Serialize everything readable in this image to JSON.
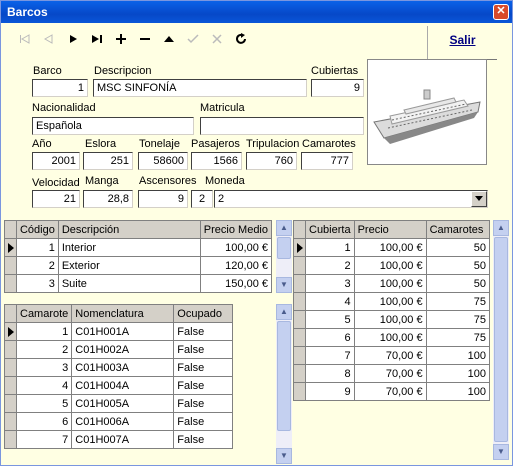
{
  "window": {
    "title": "Barcos",
    "close_glyph": "✕"
  },
  "toolbar": {
    "buttons": [
      "first-icon",
      "prev-icon",
      "next-icon",
      "last-icon",
      "add-icon",
      "remove-icon",
      "up-icon",
      "edit-icon",
      "cancel-icon",
      "refresh-icon"
    ],
    "exit_label": "Salir"
  },
  "form": {
    "barco_label": "Barco",
    "barco_value": "1",
    "descripcion_label": "Descripcion",
    "descripcion_value": "MSC SINFONÍA",
    "cubiertas_label": "Cubiertas",
    "cubiertas_value": "9",
    "nacionalidad_label": "Nacionalidad",
    "nacionalidad_value": "Española",
    "matricula_label": "Matricula",
    "matricula_value": "",
    "anio_label": "Año",
    "anio_value": "2001",
    "eslora_label": "Eslora",
    "eslora_value": "251",
    "tonelaje_label": "Tonelaje",
    "tonelaje_value": "58600",
    "pasajeros_label": "Pasajeros",
    "pasajeros_value": "1566",
    "tripulacion_label": "Tripulacion",
    "tripulacion_value": "760",
    "camarotes_label": "Camarotes",
    "camarotes_value": "777",
    "velocidad_label": "Velocidad",
    "velocidad_value": "21",
    "manga_label": "Manga",
    "manga_value": "28,8",
    "ascensores_label": "Ascensores",
    "ascensores_value": "9",
    "moneda_label": "Moneda",
    "moneda_code": "2",
    "moneda_value": "2"
  },
  "categorias": {
    "headers": [
      "Código",
      "Descripción",
      "Precio Medio"
    ],
    "rows": [
      [
        "1",
        "Interior",
        "100,00 €"
      ],
      [
        "2",
        "Exterior",
        "120,00 €"
      ],
      [
        "3",
        "Suite",
        "150,00 €"
      ]
    ]
  },
  "cubiertas": {
    "headers": [
      "Cubierta",
      "Precio",
      "Camarotes"
    ],
    "rows": [
      [
        "1",
        "100,00 €",
        "50"
      ],
      [
        "2",
        "100,00 €",
        "50"
      ],
      [
        "3",
        "100,00 €",
        "50"
      ],
      [
        "4",
        "100,00 €",
        "75"
      ],
      [
        "5",
        "100,00 €",
        "75"
      ],
      [
        "6",
        "100,00 €",
        "75"
      ],
      [
        "7",
        "70,00 €",
        "100"
      ],
      [
        "8",
        "70,00 €",
        "100"
      ],
      [
        "9",
        "70,00 €",
        "100"
      ]
    ]
  },
  "camarotes": {
    "headers": [
      "Camarote",
      "Nomenclatura",
      "Ocupado"
    ],
    "rows": [
      [
        "1",
        "C01H001A",
        "False"
      ],
      [
        "2",
        "C01H002A",
        "False"
      ],
      [
        "3",
        "C01H003A",
        "False"
      ],
      [
        "4",
        "C01H004A",
        "False"
      ],
      [
        "5",
        "C01H005A",
        "False"
      ],
      [
        "6",
        "C01H006A",
        "False"
      ],
      [
        "7",
        "C01H007A",
        "False"
      ]
    ]
  }
}
